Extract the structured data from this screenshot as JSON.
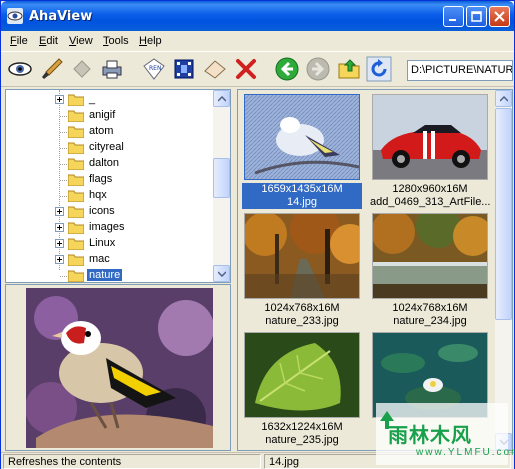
{
  "window": {
    "title": "AhaView"
  },
  "menu": [
    {
      "label": "File",
      "accel": "F",
      "rest": "ile"
    },
    {
      "label": "Edit",
      "accel": "E",
      "rest": "dit"
    },
    {
      "label": "View",
      "accel": "V",
      "rest": "iew"
    },
    {
      "label": "Tools",
      "accel": "T",
      "rest": "ools"
    },
    {
      "label": "Help",
      "accel": "H",
      "rest": "elp"
    }
  ],
  "toolbar": {
    "icons": [
      "view-eye-icon",
      "edit-brush-icon",
      "wand-icon",
      "print-icon",
      "rename-icon",
      "slideshow-film-icon",
      "erase-icon",
      "delete-x-icon",
      "back-arrow-icon",
      "forward-arrow-icon",
      "up-folder-icon",
      "refresh-icon"
    ],
    "path": "D:\\PICTURE\\NATURE"
  },
  "tree": {
    "items": [
      {
        "label": "_",
        "expandable": true,
        "selected": false
      },
      {
        "label": "anigif",
        "expandable": false,
        "selected": false
      },
      {
        "label": "atom",
        "expandable": false,
        "selected": false
      },
      {
        "label": "cityreal",
        "expandable": false,
        "selected": false
      },
      {
        "label": "dalton",
        "expandable": false,
        "selected": false
      },
      {
        "label": "flags",
        "expandable": false,
        "selected": false
      },
      {
        "label": "hqx",
        "expandable": false,
        "selected": false
      },
      {
        "label": "icons",
        "expandable": true,
        "selected": false
      },
      {
        "label": "images",
        "expandable": true,
        "selected": false
      },
      {
        "label": "Linux",
        "expandable": true,
        "selected": false
      },
      {
        "label": "mac",
        "expandable": true,
        "selected": false
      },
      {
        "label": "nature",
        "expandable": false,
        "selected": true
      }
    ]
  },
  "thumbnails": [
    {
      "info": "1659x1435x16M",
      "name": "14.jpg",
      "selected": true,
      "scene": "bird"
    },
    {
      "info": "1280x960x16M",
      "name": "add_0469_313_ArtFile...",
      "selected": false,
      "scene": "car"
    },
    {
      "info": "1024x768x16M",
      "name": "nature_233.jpg",
      "selected": false,
      "scene": "forest"
    },
    {
      "info": "1024x768x16M",
      "name": "nature_234.jpg",
      "selected": false,
      "scene": "river"
    },
    {
      "info": "1632x1224x16M",
      "name": "nature_235.jpg",
      "selected": false,
      "scene": "leaf"
    },
    {
      "info": "",
      "name": "",
      "selected": false,
      "scene": "lotus"
    }
  ],
  "status": {
    "message": "Refreshes the contents",
    "file": "14.jpg"
  },
  "watermark": {
    "text": "雨林木风",
    "url": "www.YLMFU.com"
  },
  "colors": {
    "titlebar": "#0a5ee8",
    "selection": "#316ac5",
    "panel": "#ece9d8"
  }
}
